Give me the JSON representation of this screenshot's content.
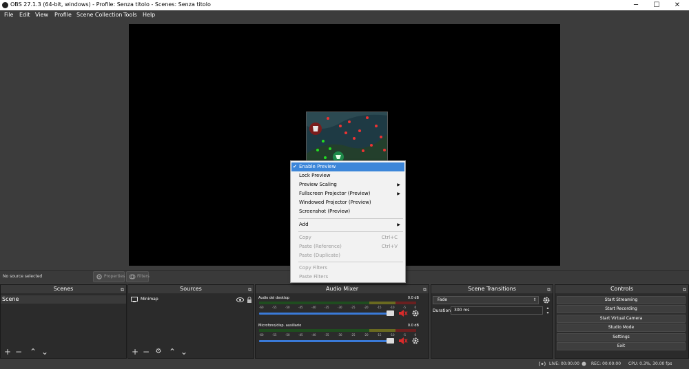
{
  "window": {
    "title": "OBS 27.1.3 (64-bit, windows) - Profile: Senza titolo - Scenes: Senza titolo",
    "minimize": "─",
    "maximize": "☐",
    "close": "✕"
  },
  "menubar": {
    "items": [
      "File",
      "Edit",
      "View",
      "Profile",
      "Scene Collection",
      "Tools",
      "Help"
    ]
  },
  "source_toolbar": {
    "no_source": "No source selected",
    "properties": "Properties",
    "filters": "Filters"
  },
  "scenes": {
    "title": "Scenes",
    "items": [
      "Scene"
    ]
  },
  "sources": {
    "title": "Sources",
    "items": [
      "Minimap"
    ]
  },
  "audio_mixer": {
    "title": "Audio Mixer",
    "ticks": [
      "-60",
      "-55",
      "-50",
      "-45",
      "-40",
      "-35",
      "-30",
      "-25",
      "-20",
      "-15",
      "-10",
      "-5",
      "0"
    ],
    "channels": [
      {
        "name": "Audio del desktop",
        "db": "0.0 dB",
        "volume": 0.96,
        "muted": true
      },
      {
        "name": "Microfono/disp. ausiliario",
        "db": "0.0 dB",
        "volume": 0.96,
        "muted": true
      }
    ]
  },
  "scene_transitions": {
    "title": "Scene Transitions",
    "transition": "Fade",
    "duration_label": "Duration",
    "duration_value": "300 ms"
  },
  "controls": {
    "title": "Controls",
    "buttons": [
      "Start Streaming",
      "Start Recording",
      "Start Virtual Camera",
      "Studio Mode",
      "Settings",
      "Exit"
    ]
  },
  "status": {
    "live": "LIVE: 00:00:00",
    "rec": "REC: 00:00:00",
    "cpu": "CPU: 0.3%, 30.00 fps"
  },
  "context_menu": {
    "enable_preview": "Enable Preview",
    "lock_preview": "Lock Preview",
    "preview_scaling": "Preview Scaling",
    "fullscreen_projector": "Fullscreen Projector (Preview)",
    "windowed_projector": "Windowed Projector (Preview)",
    "screenshot": "Screenshot (Preview)",
    "add": "Add",
    "copy": "Copy",
    "copy_shortcut": "Ctrl+C",
    "paste_reference": "Paste (Reference)",
    "paste_shortcut": "Ctrl+V",
    "paste_duplicate": "Paste (Duplicate)",
    "copy_filters": "Copy Filters",
    "paste_filters": "Paste Filters"
  },
  "colors": {
    "accent": "#3c86d9",
    "background": "#3c3c3c",
    "dock": "#2b2b2b",
    "mute": "#d92b2b"
  }
}
